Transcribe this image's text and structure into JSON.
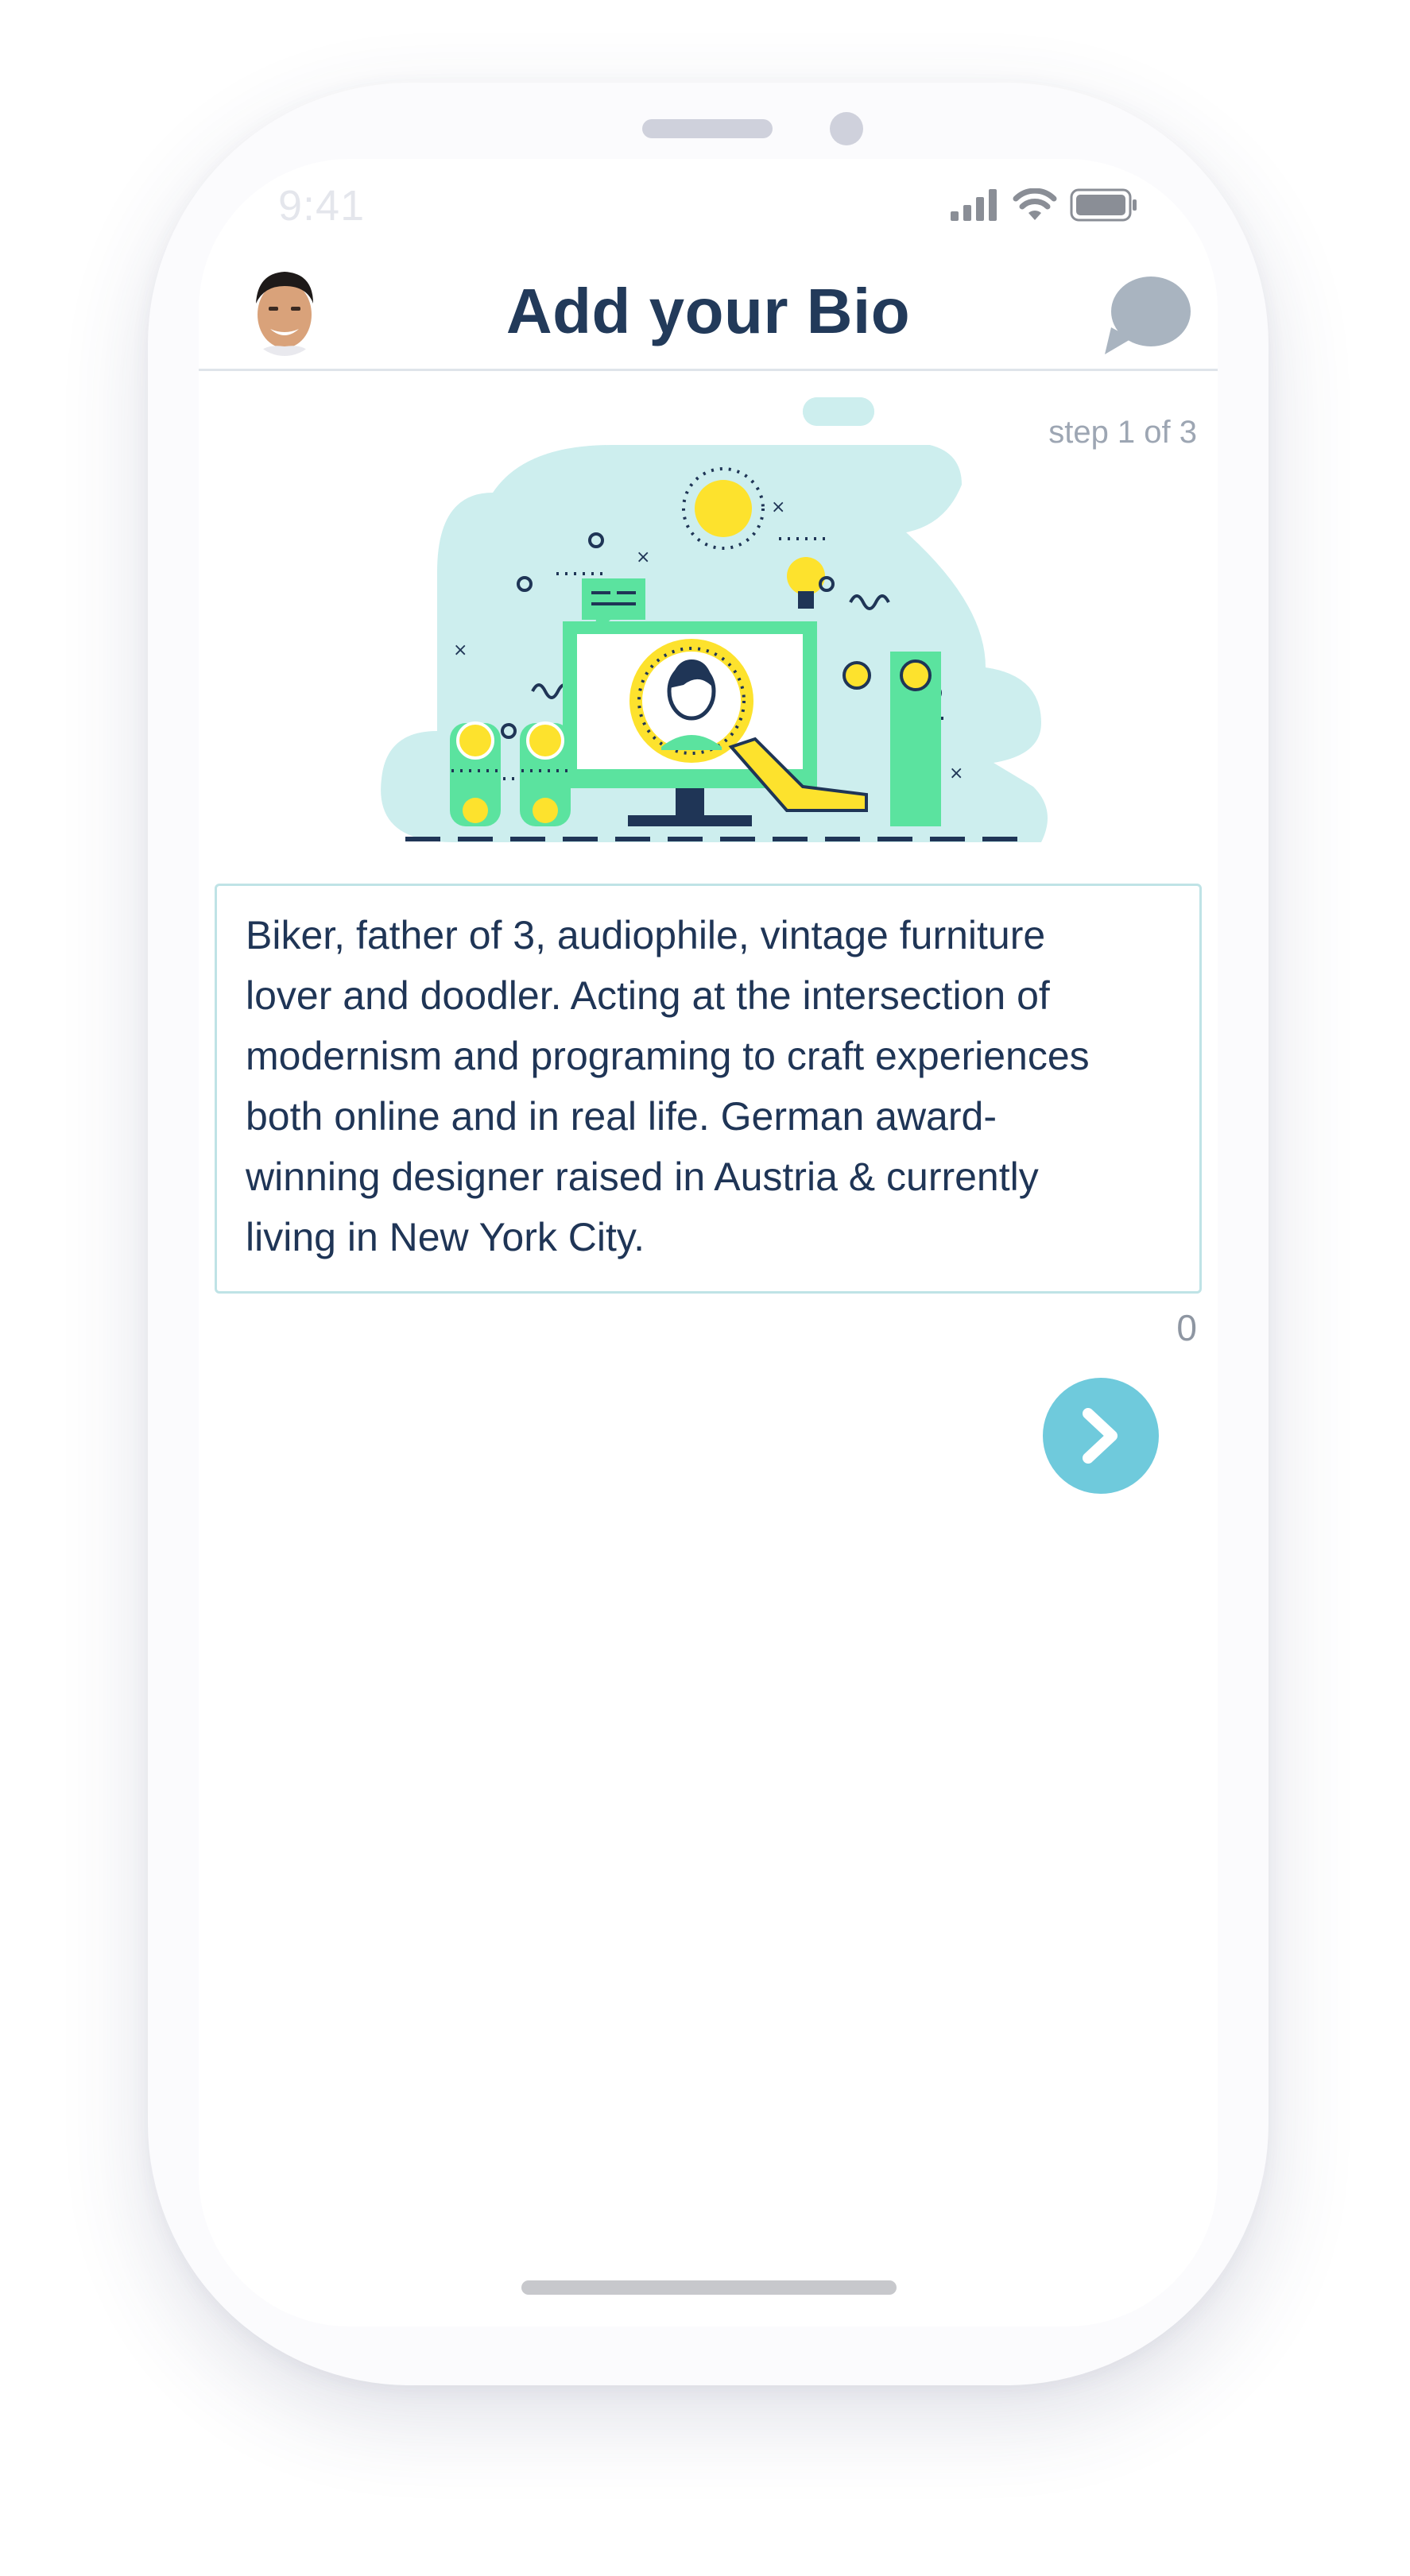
{
  "status_bar": {
    "time": "9:41",
    "icons": [
      "signal-icon",
      "wifi-icon",
      "battery-icon"
    ]
  },
  "header": {
    "title": "Add your Bio",
    "avatar_icon": "avatar",
    "chat_icon": "chat-bubble-icon"
  },
  "step_indicator": "step 1 of 3",
  "bio": {
    "text": "Biker, father of 3, audiophile, vintage furniture\nlover and doodler. Acting at the intersection of\nmodernism and programing to craft experiences\nboth online and in real life. German award-\nwinning designer raised in Austria & currently\nliving in New York City."
  },
  "char_count": "0",
  "next_button": {
    "icon": "chevron-right-icon"
  },
  "colors": {
    "title": "#223a5a",
    "accent": "#6fcadc",
    "border": "#bfe3e6",
    "illustration_blob": "#cdeeee",
    "illustration_green": "#5be39f",
    "illustration_yellow": "#fde22d",
    "illustration_navy": "#1f3556"
  }
}
